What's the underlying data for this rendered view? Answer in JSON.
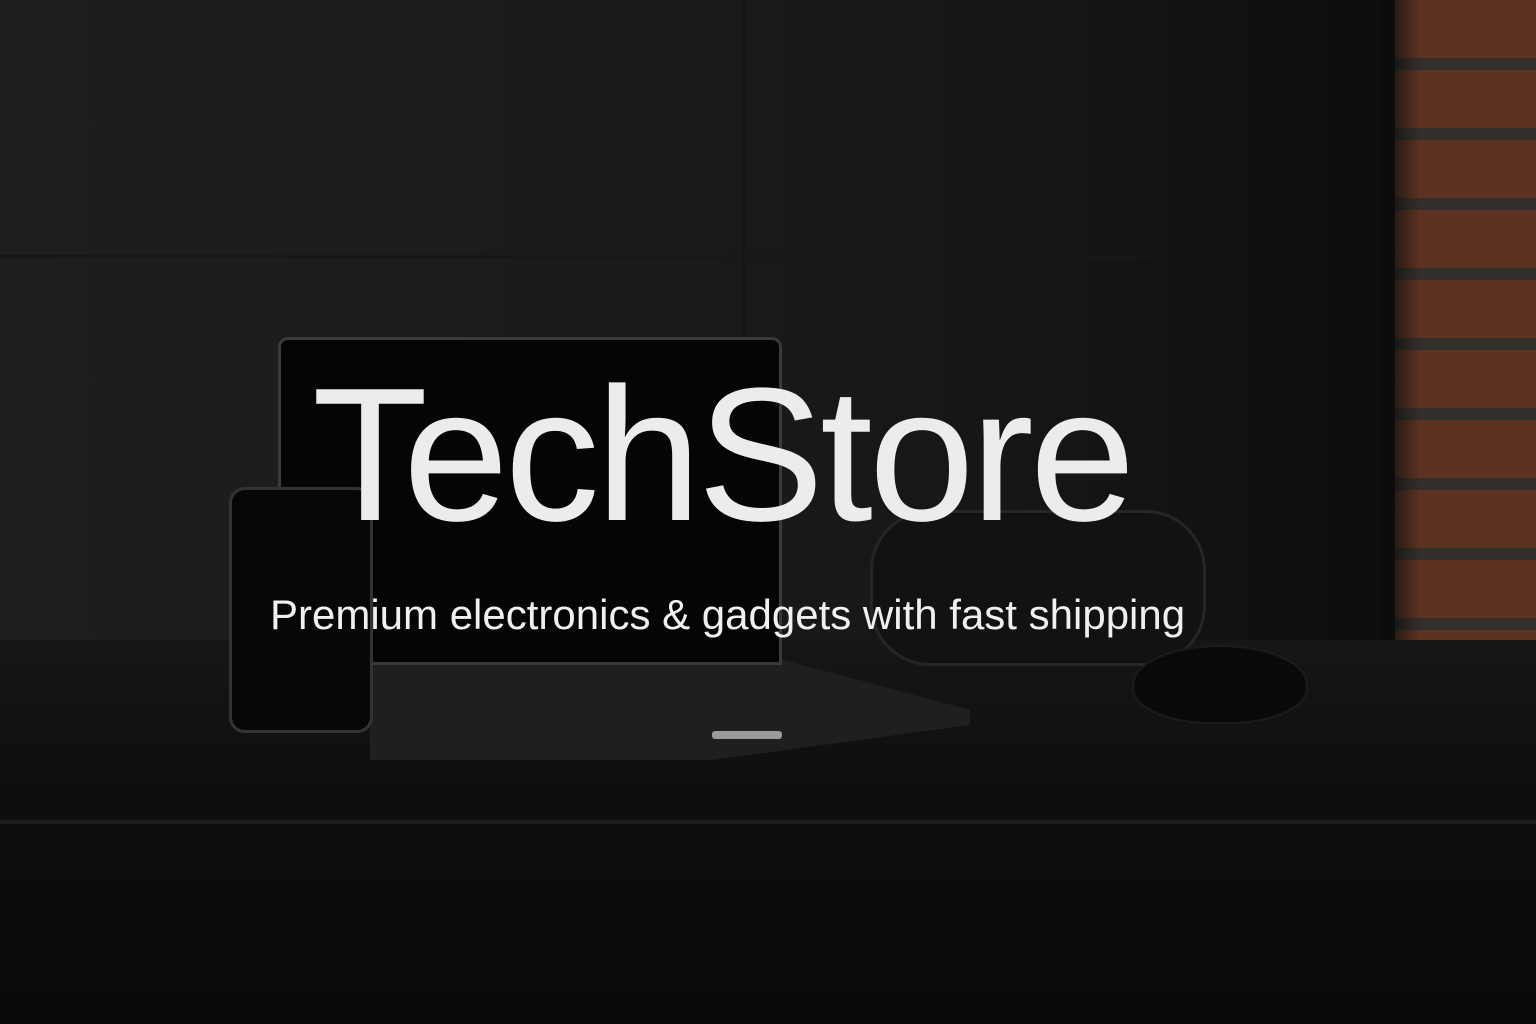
{
  "hero": {
    "title": "TechStore",
    "subtitle": "Premium electronics & gadgets with fast shipping"
  },
  "colors": {
    "background": "#1a1b1a",
    "text": "#ececec",
    "brick": "#6a3a26"
  }
}
